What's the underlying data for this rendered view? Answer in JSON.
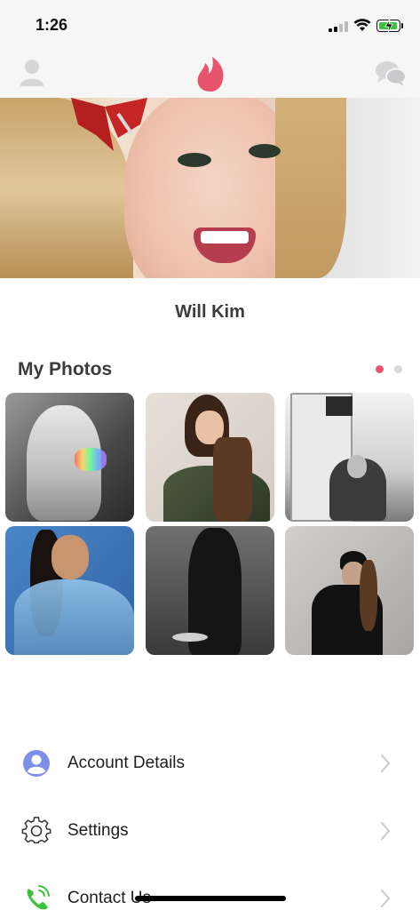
{
  "status_bar": {
    "time": "1:26"
  },
  "nav": {
    "accent_color": "#e8546b",
    "left_icon": "profile-icon",
    "center_icon": "flame-logo-icon",
    "right_icon": "chat-bubbles-icon"
  },
  "profile": {
    "name": "Will Kim"
  },
  "photos": {
    "title": "My Photos",
    "page_count": 2,
    "active_page": 1,
    "items": [
      {
        "label": "photo 1"
      },
      {
        "label": "photo 2"
      },
      {
        "label": "photo 3"
      },
      {
        "label": "photo 4"
      },
      {
        "label": "photo 5"
      },
      {
        "label": "photo 6"
      }
    ]
  },
  "menu": {
    "items": [
      {
        "label": "Account Details",
        "icon": "account-icon"
      },
      {
        "label": "Settings",
        "icon": "gear-icon"
      },
      {
        "label": "Contact Us",
        "icon": "phone-icon"
      }
    ]
  }
}
